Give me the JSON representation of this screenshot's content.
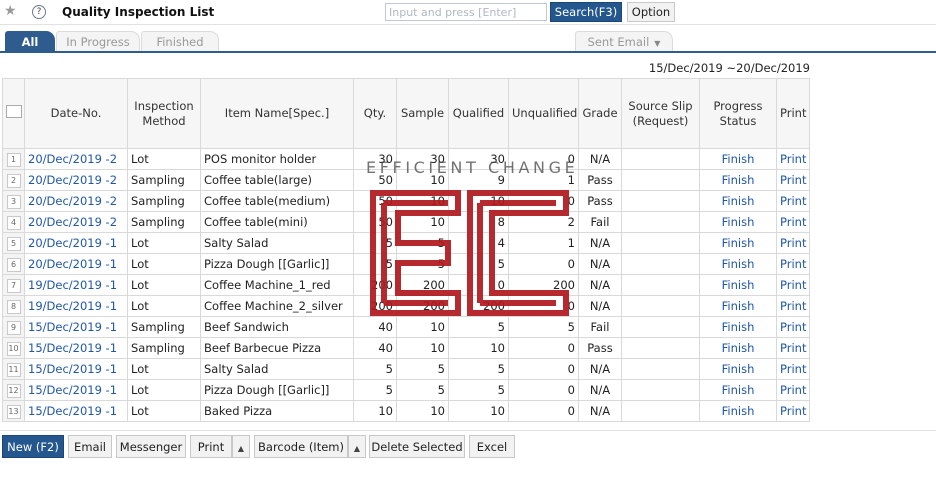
{
  "header": {
    "title": "Quality Inspection List",
    "search_placeholder": "Input and press [Enter]",
    "search_button": "Search(F3)",
    "option_button": "Option"
  },
  "tabs": {
    "all": "All",
    "in_progress": "In Progress",
    "finished": "Finished",
    "sent_email": "Sent Email"
  },
  "date_range": "15/Dec/2019 ~20/Dec/2019",
  "table": {
    "columns": {
      "date_no": "Date-No.",
      "method": "Inspection Method",
      "item": "Item Name[Spec.]",
      "qty": "Qty.",
      "sample": "Sample",
      "qualified": "Qualified",
      "unqualified": "Unqualified",
      "grade": "Grade",
      "source": "Source Slip (Request)",
      "progress": "Progress Status",
      "print": "Print"
    },
    "rows": [
      {
        "n": "1",
        "date": "20/Dec/2019 -2",
        "method": "Lot",
        "item": "POS monitor holder",
        "qty": "30",
        "sample": "30",
        "qualified": "30",
        "unqualified": "0",
        "grade": "N/A",
        "status": "Finish",
        "print": "Print"
      },
      {
        "n": "2",
        "date": "20/Dec/2019 -2",
        "method": "Sampling",
        "item": "Coffee table(large)",
        "qty": "50",
        "sample": "10",
        "qualified": "9",
        "unqualified": "1",
        "grade": "Pass",
        "status": "Finish",
        "print": "Print"
      },
      {
        "n": "3",
        "date": "20/Dec/2019 -2",
        "method": "Sampling",
        "item": "Coffee table(medium)",
        "qty": "50",
        "sample": "10",
        "qualified": "10",
        "unqualified": "0",
        "grade": "Pass",
        "status": "Finish",
        "print": "Print"
      },
      {
        "n": "4",
        "date": "20/Dec/2019 -2",
        "method": "Sampling",
        "item": "Coffee table(mini)",
        "qty": "50",
        "sample": "10",
        "qualified": "8",
        "unqualified": "2",
        "grade": "Fail",
        "status": "Finish",
        "print": "Print"
      },
      {
        "n": "5",
        "date": "20/Dec/2019 -1",
        "method": "Lot",
        "item": "Salty Salad",
        "qty": "5",
        "sample": "5",
        "qualified": "4",
        "unqualified": "1",
        "grade": "N/A",
        "status": "Finish",
        "print": "Print"
      },
      {
        "n": "6",
        "date": "20/Dec/2019 -1",
        "method": "Lot",
        "item": "Pizza Dough [[Garlic]]",
        "qty": "5",
        "sample": "5",
        "qualified": "5",
        "unqualified": "0",
        "grade": "N/A",
        "status": "Finish",
        "print": "Print"
      },
      {
        "n": "7",
        "date": "19/Dec/2019 -1",
        "method": "Lot",
        "item": "Coffee Machine_1_red",
        "qty": "200",
        "sample": "200",
        "qualified": "0",
        "unqualified": "200",
        "grade": "N/A",
        "status": "Finish",
        "print": "Print"
      },
      {
        "n": "8",
        "date": "19/Dec/2019 -1",
        "method": "Lot",
        "item": "Coffee Machine_2_silver",
        "qty": "200",
        "sample": "200",
        "qualified": "200",
        "unqualified": "0",
        "grade": "N/A",
        "status": "Finish",
        "print": "Print"
      },
      {
        "n": "9",
        "date": "15/Dec/2019 -1",
        "method": "Sampling",
        "item": "Beef Sandwich",
        "qty": "40",
        "sample": "10",
        "qualified": "5",
        "unqualified": "5",
        "grade": "Fail",
        "status": "Finish",
        "print": "Print"
      },
      {
        "n": "10",
        "date": "15/Dec/2019 -1",
        "method": "Sampling",
        "item": "Beef Barbecue Pizza",
        "qty": "40",
        "sample": "10",
        "qualified": "10",
        "unqualified": "0",
        "grade": "Pass",
        "status": "Finish",
        "print": "Print"
      },
      {
        "n": "11",
        "date": "15/Dec/2019 -1",
        "method": "Lot",
        "item": "Salty Salad",
        "qty": "5",
        "sample": "5",
        "qualified": "5",
        "unqualified": "0",
        "grade": "N/A",
        "status": "Finish",
        "print": "Print"
      },
      {
        "n": "12",
        "date": "15/Dec/2019 -1",
        "method": "Lot",
        "item": "Pizza Dough [[Garlic]]",
        "qty": "5",
        "sample": "5",
        "qualified": "5",
        "unqualified": "0",
        "grade": "N/A",
        "status": "Finish",
        "print": "Print"
      },
      {
        "n": "13",
        "date": "15/Dec/2019 -1",
        "method": "Lot",
        "item": "Baked Pizza",
        "qty": "10",
        "sample": "10",
        "qualified": "10",
        "unqualified": "0",
        "grade": "N/A",
        "status": "Finish",
        "print": "Print"
      }
    ]
  },
  "watermark": {
    "text": "EFFICIENT CHANGE",
    "logo": "EC",
    "color": "#b0191e"
  },
  "buttons": {
    "new": "New (F2)",
    "email": "Email",
    "messenger": "Messenger",
    "print": "Print",
    "barcode": "Barcode (Item)",
    "delete": "Delete Selected",
    "excel": "Excel"
  },
  "icons": {
    "star": "star-icon",
    "help": "help-icon",
    "dropdown": "caret-down-icon",
    "print_menu": "caret-up-icon",
    "barcode_menu": "caret-up-icon"
  },
  "colors": {
    "primary": "#24578e",
    "tab_active": "#2e5c8f",
    "link": "#1f56a8"
  }
}
